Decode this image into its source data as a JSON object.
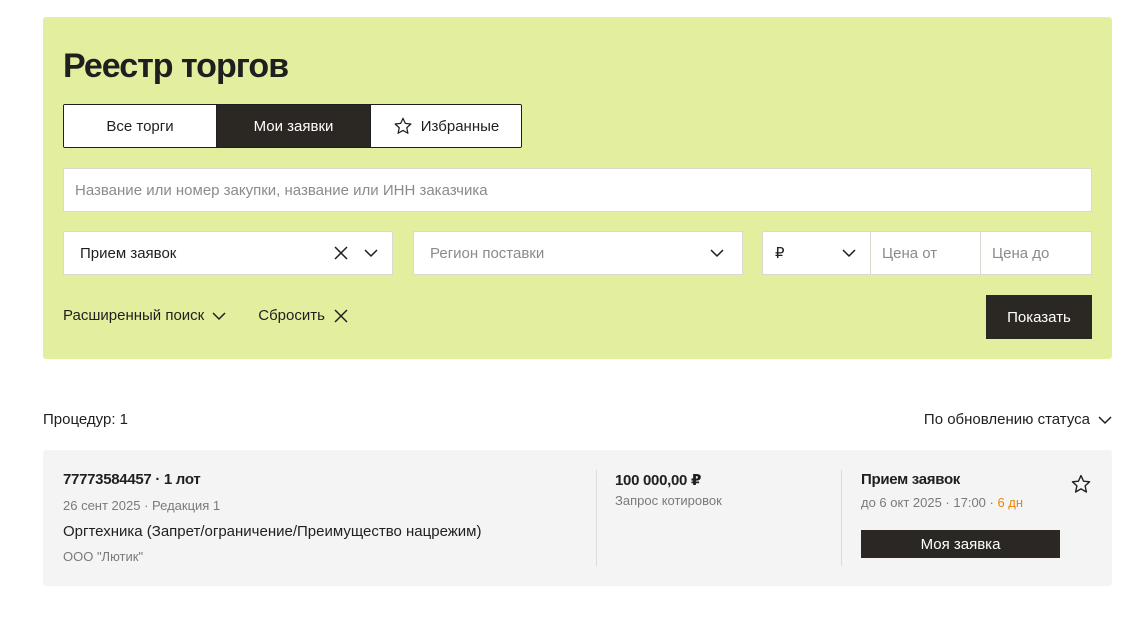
{
  "page_title": "Реестр торгов",
  "tabs": [
    {
      "label": "Все торги",
      "active": false
    },
    {
      "label": "Мои заявки",
      "active": true
    },
    {
      "label": "Избранные",
      "active": false,
      "icon": "star-icon"
    }
  ],
  "search": {
    "placeholder": "Название или номер закупки, название или ИНН заказчика",
    "value": ""
  },
  "filters": {
    "status": {
      "value": "Прием заявок"
    },
    "region": {
      "placeholder": "Регион поставки"
    },
    "currency": {
      "value": "₽"
    },
    "price_from": {
      "placeholder": "Цена от"
    },
    "price_to": {
      "placeholder": "Цена до"
    }
  },
  "advanced_search_label": "Расширенный поиск",
  "reset_label": "Сбросить",
  "show_button_label": "Показать",
  "results": {
    "count_label": "Процедур: 1",
    "sort_label": "По обновлению статуса"
  },
  "procedures": [
    {
      "number": "77773584457 · 1 лот",
      "date": "26 сент 2025 · Редакция 1",
      "subject": "Оргтехника  (Запрет/ограничение/Преимущество нацрежим)",
      "customer": "ООО \"Лютик\"",
      "price": "100 000,00 ₽",
      "procedure_type": "Запрос котировок",
      "status": "Прием заявок",
      "deadline": "до 6 окт 2025 · 17:00 · ",
      "days_left": "6 дн",
      "action_label": "Моя заявка"
    }
  ],
  "colors": {
    "panel_bg": "#e3ef9e",
    "dark": "#2b2823",
    "card_bg": "#f4f4f4",
    "days_accent": "#e8860b"
  }
}
